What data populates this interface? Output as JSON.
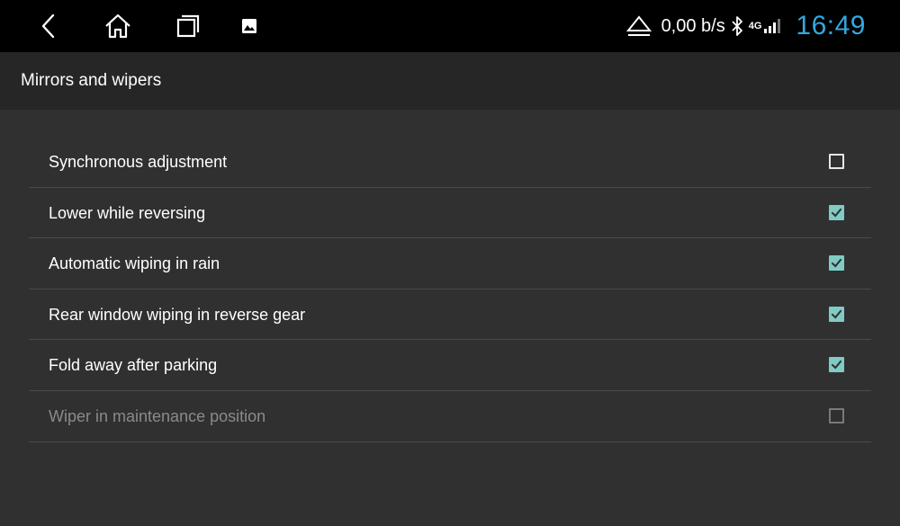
{
  "status_bar": {
    "nav_icons": [
      "back-icon",
      "home-icon",
      "recents-icon",
      "gallery-icon"
    ],
    "status_icons": [
      "eject-icon",
      "bluetooth-icon",
      "signal-icon"
    ],
    "network_speed": "0,00 b/s",
    "network_type": "4G",
    "clock": "16:49",
    "clock_color": "#34a8df"
  },
  "header": {
    "title": "Mirrors and wipers"
  },
  "settings": {
    "accent_color": "#80cbc4",
    "items": [
      {
        "label": "Synchronous adjustment",
        "checked": false,
        "enabled": true
      },
      {
        "label": "Lower while reversing",
        "checked": true,
        "enabled": true
      },
      {
        "label": "Automatic wiping in rain",
        "checked": true,
        "enabled": true
      },
      {
        "label": "Rear window wiping in reverse gear",
        "checked": true,
        "enabled": true
      },
      {
        "label": "Fold away after parking",
        "checked": true,
        "enabled": true
      },
      {
        "label": "Wiper in maintenance position",
        "checked": false,
        "enabled": false
      }
    ]
  }
}
